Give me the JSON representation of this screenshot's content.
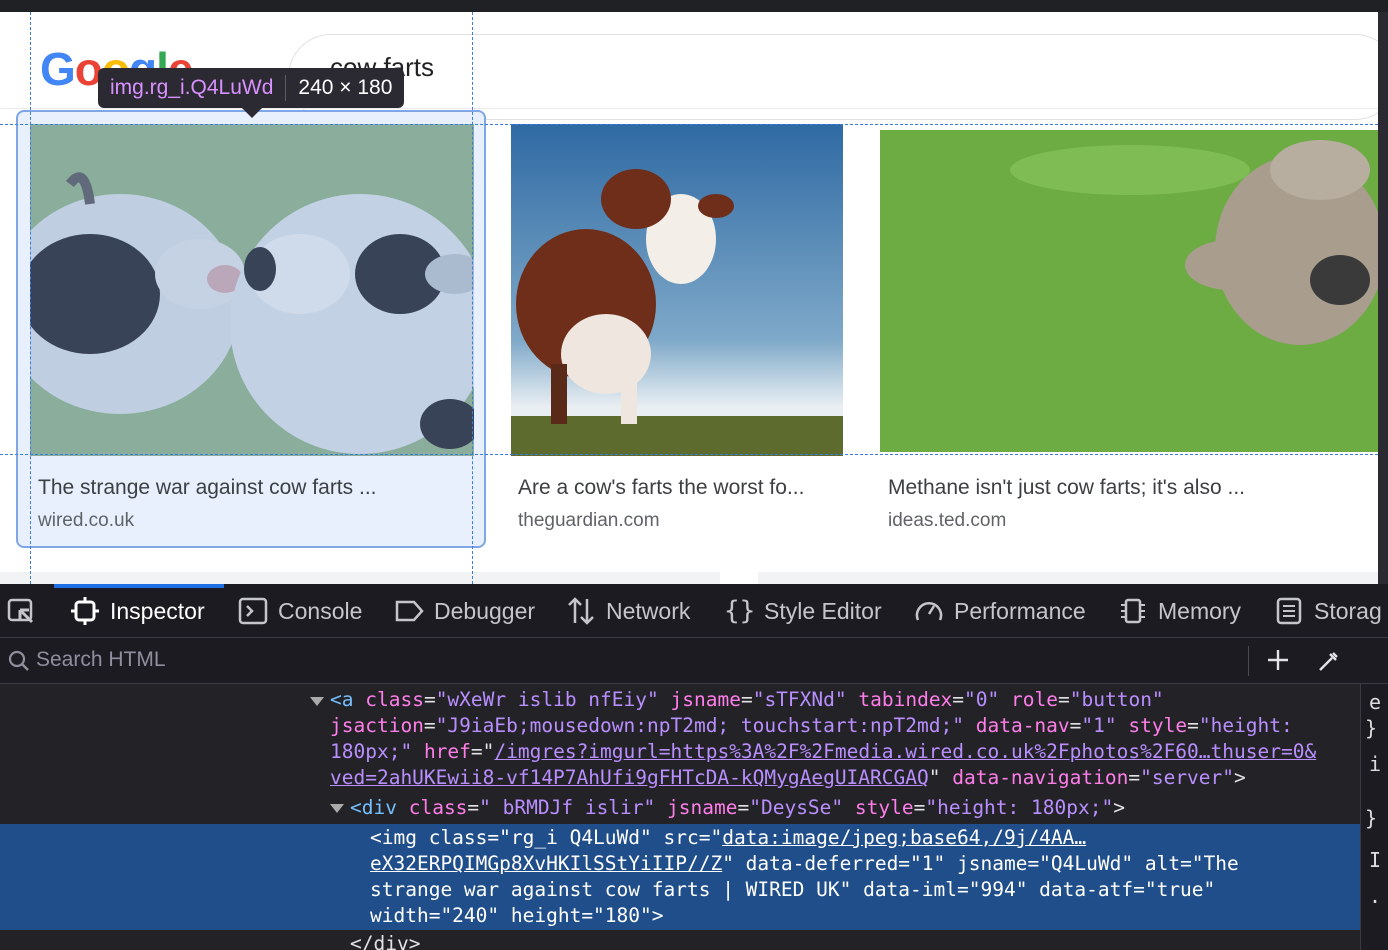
{
  "browser": {
    "logo_text": "Google",
    "search_query": "cow farts"
  },
  "inspector_tooltip": {
    "selector": "img.rg_i.Q4LuWd",
    "size": "240 × 180"
  },
  "results": [
    {
      "caption": "The strange war against cow farts ...",
      "domain": "wired.co.uk"
    },
    {
      "caption": "Are a cow's farts the worst fo...",
      "domain": "theguardian.com"
    },
    {
      "caption": "Methane isn't just cow farts; it's also ...",
      "domain": "ideas.ted.com"
    }
  ],
  "devtools": {
    "tabs": [
      {
        "label": "Inspector",
        "icon": "inspector-icon",
        "active": true
      },
      {
        "label": "Console",
        "icon": "console-icon"
      },
      {
        "label": "Debugger",
        "icon": "debugger-icon"
      },
      {
        "label": "Network",
        "icon": "network-icon"
      },
      {
        "label": "Style Editor",
        "icon": "style-editor-icon"
      },
      {
        "label": "Performance",
        "icon": "performance-icon"
      },
      {
        "label": "Memory",
        "icon": "memory-icon"
      },
      {
        "label": "Storag",
        "icon": "storage-icon"
      }
    ],
    "search_placeholder": "Search HTML",
    "markup": {
      "a_open": "<a",
      "a_class_attr": "class",
      "a_class_val": "\"wXeWr islib nfEiy\"",
      "a_jsname_attr": "jsname",
      "a_jsname_val": "\"sTFXNd\"",
      "a_tabindex_attr": "tabindex",
      "a_tabindex_val": "\"0\"",
      "a_role_attr": "role",
      "a_role_val": "\"button\"",
      "a_jsaction_attr": "jsaction",
      "a_jsaction_val": "\"J9iaEb;mousedown:npT2md; touchstart:npT2md;\"",
      "a_datanav_attr": "data-nav",
      "a_datanav_val": "\"1\"",
      "a_style_attr": "style",
      "a_style_val_1": "\"height:",
      "a_style_val_2": "180px;\"",
      "a_href_attr": "href",
      "a_href_val_1": "/imgres?imgurl=https%3A%2F%2Fmedia.wired.co.uk%2Fphotos%2F60…thuser=0&",
      "a_href_val_2": "ved=2ahUKEwii8-vf14P7AhUfi9gFHTcDA-kQMygAegUIARCGAQ",
      "a_datanavigation_attr": "data-navigation",
      "a_datanavigation_val": "\"server\"",
      "div_open": "<div",
      "div_class_attr": "class",
      "div_class_val": "\" bRMDJf islir\"",
      "div_jsname_attr": "jsname",
      "div_jsname_val": "\"DeysSe\"",
      "div_style_attr": "style",
      "div_style_val": "\"height: 180px;\"",
      "img_line1_a": "<img class=\"rg_i Q4LuWd\" src=\"",
      "img_line1_b": "data:image/jpeg;base64,/9j/4AA…",
      "img_line2_a": "eX32ERPQIMGp8XvHKIlSStYiIIP//Z",
      "img_line2_b": "\" data-deferred=\"1\" jsname=\"Q4LuWd\" alt=\"The",
      "img_line3": "strange war against cow farts | WIRED UK\" data-iml=\"994\" data-atf=\"true\"",
      "img_line4": "width=\"240\" height=\"180\">",
      "div_close": "</div>"
    },
    "side_glyphs": [
      "e",
      "}",
      "i",
      "}",
      "I",
      "."
    ]
  }
}
